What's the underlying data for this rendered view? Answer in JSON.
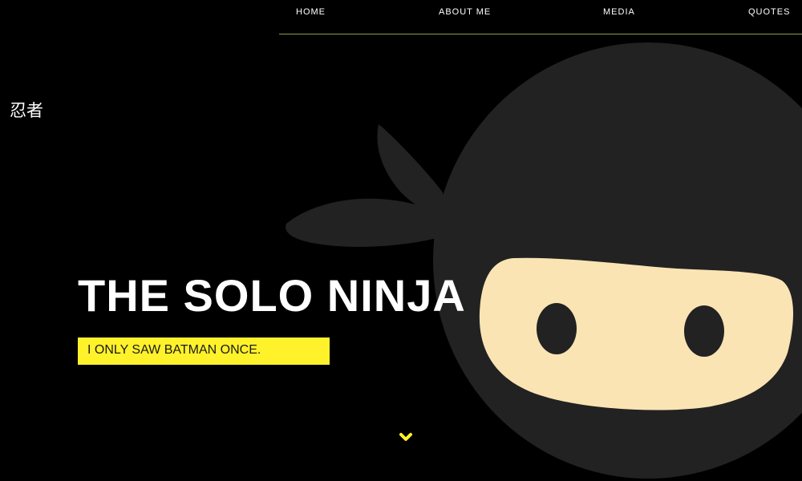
{
  "nav": {
    "items": [
      {
        "label": "HOME"
      },
      {
        "label": "ABOUT ME"
      },
      {
        "label": "MEDIA"
      },
      {
        "label": "QUOTES"
      }
    ]
  },
  "logo": {
    "text": "忍者"
  },
  "hero": {
    "title": "THE SOLO NINJA",
    "tagline": "I ONLY SAW BATMAN ONCE."
  },
  "icons": {
    "scroll_down": "chevron-down-icon"
  },
  "colors": {
    "background": "#000000",
    "accent": "#fff22a",
    "nav_rule": "#8f9e3c",
    "ninja_body": "#222222",
    "ninja_face": "#fae4b4"
  }
}
